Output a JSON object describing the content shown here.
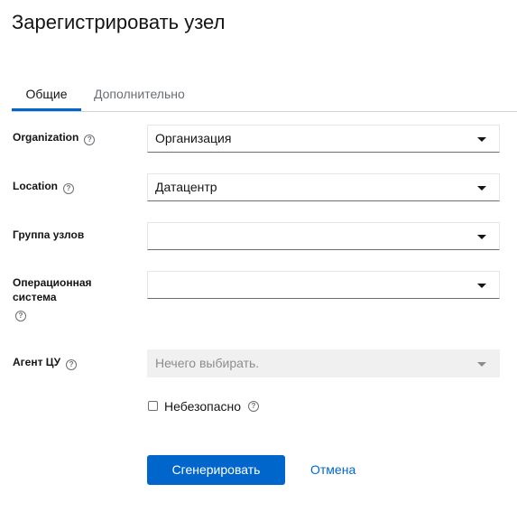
{
  "page_title": "Зарегистрировать узел",
  "tabs": [
    {
      "label": "Общие",
      "active": true
    },
    {
      "label": "Дополнительно",
      "active": false
    }
  ],
  "form": {
    "organization": {
      "label": "Organization",
      "value": "Организация",
      "help_icon": "question-circle-icon"
    },
    "location": {
      "label": "Location",
      "value": "Датацентр",
      "help_icon": "question-circle-icon"
    },
    "host_group": {
      "label": "Группа узлов",
      "value": ""
    },
    "os": {
      "label_line1": "Операционная",
      "label_line2": "система",
      "value": "",
      "help_icon": "question-circle-icon"
    },
    "cc_agent": {
      "label": "Агент ЦУ",
      "value": "Нечего выбирать.",
      "disabled": true,
      "help_icon": "question-circle-icon"
    },
    "insecure": {
      "label": "Небезопасно",
      "checked": false,
      "help_icon": "question-circle-icon"
    }
  },
  "actions": {
    "generate_label": "Сгенерировать",
    "cancel_label": "Отмена"
  },
  "colors": {
    "accent": "#0066cc",
    "text": "#151515",
    "muted": "#6a6e73",
    "disabled_bg": "#f0f0f0"
  }
}
